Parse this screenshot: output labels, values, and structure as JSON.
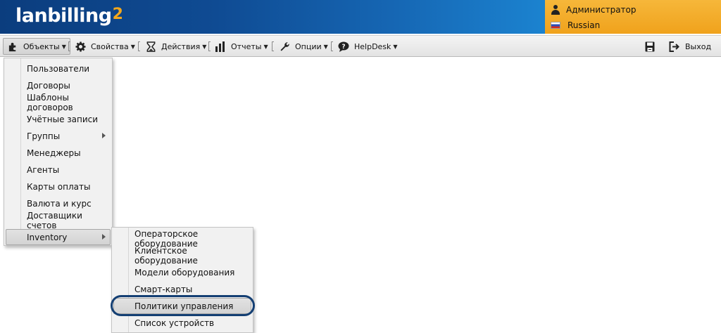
{
  "app": {
    "logo_text": "lanbilling",
    "logo_superscript": "2"
  },
  "user_panel": {
    "username": "Администратор",
    "language": "Russian"
  },
  "toolbar": {
    "items": [
      {
        "label": "Объекты",
        "icon": "puzzle-icon"
      },
      {
        "label": "Свойства",
        "icon": "gear-icon"
      },
      {
        "label": "Действия",
        "icon": "hourglass-icon"
      },
      {
        "label": "Отчеты",
        "icon": "bar-chart-icon"
      },
      {
        "label": "Опции",
        "icon": "wrench-icon"
      },
      {
        "label": "HelpDesk",
        "icon": "speech-bubble-icon"
      }
    ],
    "exit_label": "Выход"
  },
  "objects_menu": {
    "items": [
      {
        "label": "Пользователи"
      },
      {
        "label": "Договоры"
      },
      {
        "label": "Шаблоны договоров"
      },
      {
        "label": "Учётные записи"
      },
      {
        "label": "Группы",
        "has_submenu": true
      },
      {
        "label": "Менеджеры"
      },
      {
        "label": "Агенты"
      },
      {
        "label": "Карты оплаты"
      },
      {
        "label": "Валюта и курс"
      },
      {
        "label": "Доставщики счетов"
      },
      {
        "label": "Inventory",
        "has_submenu": true,
        "active": true
      }
    ]
  },
  "inventory_menu": {
    "items": [
      {
        "label": "Операторское оборудование"
      },
      {
        "label": "Клиентское оборудование"
      },
      {
        "label": "Модели оборудования"
      },
      {
        "label": "Смарт-карты"
      },
      {
        "label": "Политики управления",
        "active": true
      },
      {
        "label": "Список устройств"
      }
    ]
  },
  "colors": {
    "header_start": "#0b3d7e",
    "header_end": "#2a8fd6",
    "user_panel": "#f0a21c",
    "logo_accent": "#f3a71c",
    "highlight_ring": "#143f73"
  }
}
